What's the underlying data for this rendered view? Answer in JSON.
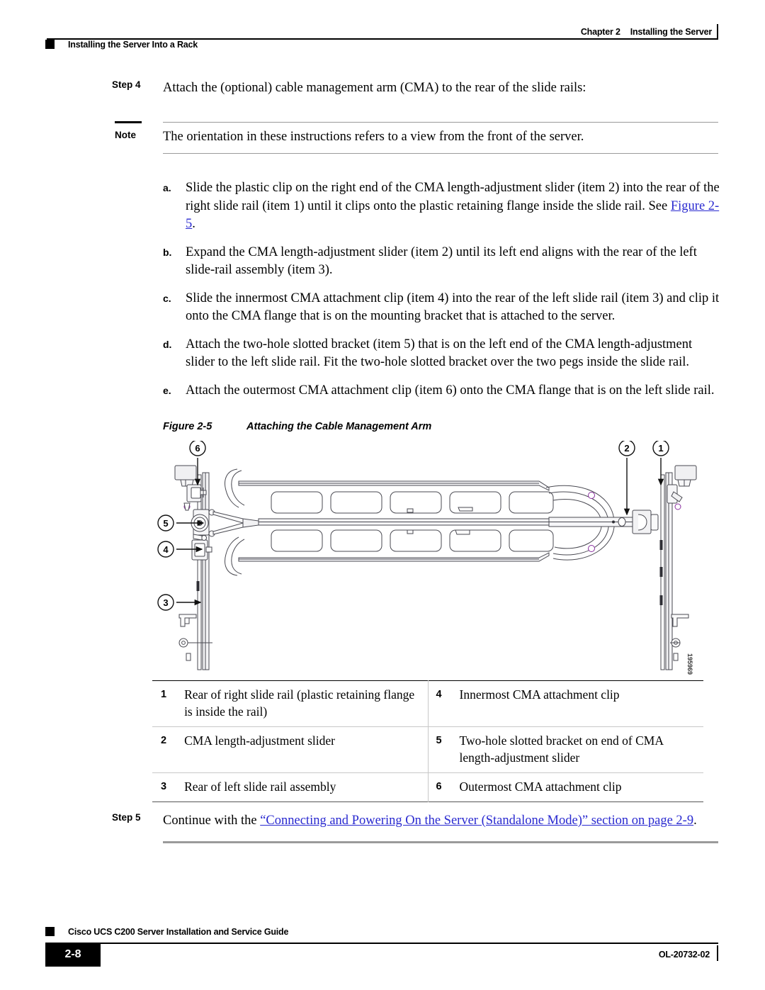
{
  "header": {
    "chapter": "Chapter 2",
    "chapter_title": "Installing the Server",
    "section_title": "Installing the Server Into a Rack"
  },
  "step4": {
    "label": "Step 4",
    "text": "Attach the (optional) cable management arm (CMA) to the rear of the slide rails:"
  },
  "note": {
    "label": "Note",
    "text": "The orientation in these instructions refers to a view from the front of the server."
  },
  "substeps": [
    {
      "letter": "a.",
      "text_before_link": "Slide the plastic clip on the right end of the CMA length-adjustment slider (item 2) into the rear of the right slide rail (item 1) until it clips onto the plastic retaining flange inside the slide rail. See ",
      "link": "Figure 2-5",
      "text_after_link": "."
    },
    {
      "letter": "b.",
      "text_before_link": "Expand the CMA length-adjustment slider (item 2) until its left end aligns with the rear of the left slide-rail assembly (item 3).",
      "link": "",
      "text_after_link": ""
    },
    {
      "letter": "c.",
      "text_before_link": "Slide the innermost CMA attachment clip (item 4) into the rear of the left slide rail (item 3) and clip it onto the CMA flange that is on the mounting bracket that is attached to the server.",
      "link": "",
      "text_after_link": ""
    },
    {
      "letter": "d.",
      "text_before_link": "Attach the two-hole slotted bracket (item 5) that is on the left end of the CMA length-adjustment slider to the left slide rail. Fit the two-hole slotted bracket over the two pegs inside the slide rail.",
      "link": "",
      "text_after_link": ""
    },
    {
      "letter": "e.",
      "text_before_link": "Attach the outermost CMA attachment clip (item 6) onto the CMA flange that is on the left slide rail.",
      "link": "",
      "text_after_link": ""
    }
  ],
  "figure": {
    "number": "Figure 2-5",
    "title": "Attaching the Cable Management Arm",
    "art_id": "195969",
    "callouts": [
      {
        "id": "1",
        "label": "1"
      },
      {
        "id": "2",
        "label": "2"
      },
      {
        "id": "3",
        "label": "3"
      },
      {
        "id": "4",
        "label": "4"
      },
      {
        "id": "5",
        "label": "5"
      },
      {
        "id": "6",
        "label": "6"
      }
    ]
  },
  "item_table": {
    "rows": [
      {
        "left_num": "1",
        "left_desc": "Rear of right slide rail (plastic retaining flange is inside the rail)",
        "right_num": "4",
        "right_desc": "Innermost CMA attachment clip"
      },
      {
        "left_num": "2",
        "left_desc": "CMA length-adjustment slider",
        "right_num": "5",
        "right_desc": "Two-hole slotted bracket on end of CMA length-adjustment slider"
      },
      {
        "left_num": "3",
        "left_desc": "Rear of left slide rail assembly",
        "right_num": "6",
        "right_desc": "Outermost CMA attachment clip"
      }
    ]
  },
  "step5": {
    "label": "Step 5",
    "text_before_link": "Continue with the ",
    "link": "“Connecting and Powering On the Server (Standalone Mode)” section on page 2-9",
    "text_after_link": "."
  },
  "footer": {
    "guide_title": "Cisco UCS C200 Server Installation and Service Guide",
    "page_number": "2-8",
    "doc_id": "OL-20732-02"
  },
  "colors": {
    "link": "#2a2ad0",
    "rule": "#9a9a9a",
    "text": "#000000"
  }
}
